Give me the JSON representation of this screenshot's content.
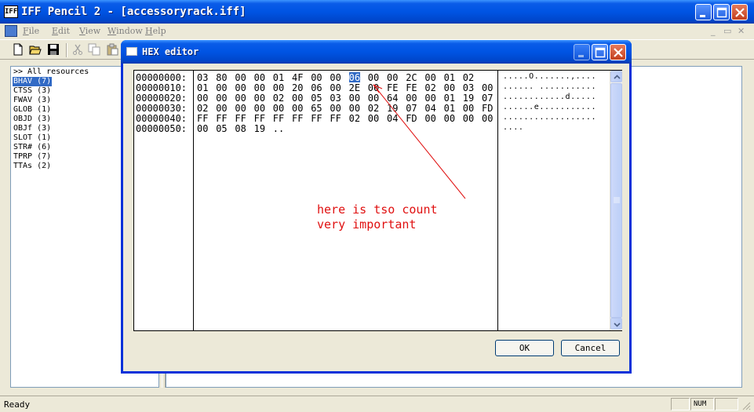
{
  "window": {
    "title": "IFF Pencil 2 - [accessoryrack.iff]",
    "app_icon_text": "IFF"
  },
  "menubar": {
    "items": [
      {
        "mnemonic": "F",
        "rest": "ile"
      },
      {
        "mnemonic": "E",
        "rest": "dit"
      },
      {
        "mnemonic": "V",
        "rest": "iew"
      },
      {
        "mnemonic": "W",
        "rest": "indow"
      },
      {
        "mnemonic": "H",
        "rest": "elp"
      }
    ]
  },
  "resources": {
    "items": [
      {
        "label": ">> All resources",
        "selected": false
      },
      {
        "label": "BHAV (7)",
        "selected": true
      },
      {
        "label": "CTSS (3)",
        "selected": false
      },
      {
        "label": "FWAV (3)",
        "selected": false
      },
      {
        "label": "GLOB (1)",
        "selected": false
      },
      {
        "label": "OBJD (3)",
        "selected": false
      },
      {
        "label": "OBJf (3)",
        "selected": false
      },
      {
        "label": "SLOT (1)",
        "selected": false
      },
      {
        "label": "STR# (6)",
        "selected": false
      },
      {
        "label": "TPRP (7)",
        "selected": false
      },
      {
        "label": "TTAs (2)",
        "selected": false
      }
    ]
  },
  "status": {
    "text": "Ready",
    "num": "NUM"
  },
  "hex_editor": {
    "title": "HEX editor",
    "addresses": [
      "00000000:",
      "00000010:",
      "00000020:",
      "00000030:",
      "00000040:",
      "00000050:"
    ],
    "rows": [
      [
        "03",
        "80",
        "00",
        "00",
        "01",
        "4F",
        "00",
        "00",
        "06",
        "00",
        "00",
        "2C",
        "00",
        "01",
        "02"
      ],
      [
        "01",
        "00",
        "00",
        "00",
        "00",
        "20",
        "06",
        "00",
        "2E",
        "00",
        "FE",
        "FE",
        "02",
        "00",
        "03",
        "00"
      ],
      [
        "00",
        "00",
        "00",
        "00",
        "02",
        "00",
        "05",
        "03",
        "00",
        "00",
        "64",
        "00",
        "00",
        "01",
        "19",
        "07"
      ],
      [
        "02",
        "00",
        "00",
        "00",
        "00",
        "00",
        "65",
        "00",
        "00",
        "02",
        "19",
        "07",
        "04",
        "01",
        "00",
        "FD"
      ],
      [
        "FF",
        "FF",
        "FF",
        "FF",
        "FF",
        "FF",
        "FF",
        "FF",
        "02",
        "00",
        "04",
        "FD",
        "00",
        "00",
        "00",
        "00"
      ],
      [
        "00",
        "05",
        "08",
        "19",
        ".."
      ]
    ],
    "selected": {
      "row": 0,
      "col": 8
    },
    "ascii": [
      ".....O.......,....",
      "...... ...........",
      "............d.....",
      "......e...........",
      "..................",
      "...."
    ],
    "annotation": [
      "here is tso count",
      "very important"
    ],
    "annotation_color": "#e01010",
    "ok_label": "OK",
    "cancel_label": "Cancel"
  }
}
